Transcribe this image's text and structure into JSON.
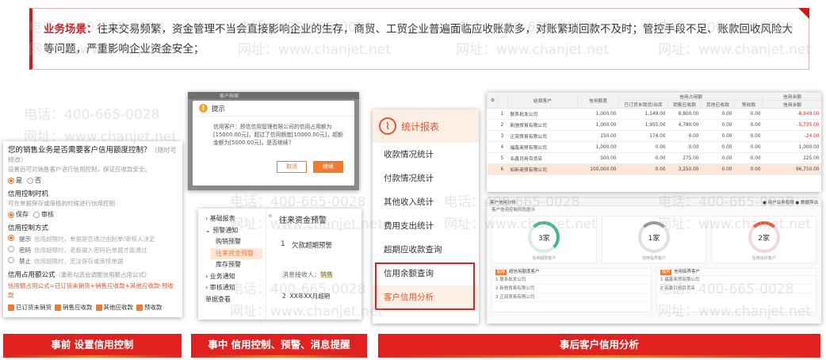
{
  "scenario": {
    "label": "业务场景：",
    "text": "往来交易频繁，资金管理不当会直接影响企业的生存，商贸、工贸企业普遍面临应收账款多，对账繁琐回款不及时；管控手段不足、账款回收风险大等问题，严重影响企业资金安全；"
  },
  "watermark": {
    "phone": "电话：400-665-0028",
    "site": "网址：www.chanjet.net"
  },
  "settings": {
    "question": "您的销售业务是否需要客户信用额度控制？",
    "question_hint": "（随时可修改）",
    "question_sub": "设置后可对销售客户进行信用控制，保证应收款安全。",
    "yes": "是",
    "no": "否",
    "timing_title": "信用控制时机",
    "timing_sub": "可在单据保存或审核的时候进行信用控制",
    "save": "保存",
    "audit": "审核",
    "method_title": "信用控制方式",
    "methods": [
      {
        "name": "提示",
        "desc": "信用超限时，单据是否通过由制单/审核人决定"
      },
      {
        "name": "密码",
        "desc": "信用超限时，老板输入密码后单据才能通过"
      },
      {
        "name": "禁止",
        "desc": "信用超限时，无法保存或审核单据"
      }
    ],
    "formula_title": "信用占用额公式",
    "formula_hint": "（重新勾选会调整信用额占用公式）",
    "formula": "信用额占用公式=已订货未销货+销售应收款+其他应收款-预收款",
    "checks": [
      "已订货未销货",
      "销售应收款",
      "其他应收款",
      "预收款"
    ]
  },
  "dialog": {
    "strip": "客户档案",
    "title": "提示",
    "body": "信用客户：即信信用管理有限公司的信用占用额为[15000.00元]，超过了信用额度[10000.00元]，超额金额为[5000.00元]，是否继续？",
    "cancel": "取消",
    "ok": "继续"
  },
  "alert_menu": {
    "items": [
      {
        "label": "基础报表",
        "sub": false,
        "prefix": "›"
      },
      {
        "label": "预警通知",
        "sub": false,
        "prefix": "⌄"
      },
      {
        "label": "购销预警",
        "sub": true
      },
      {
        "label": "往来资金预警",
        "sub": true,
        "active": true
      },
      {
        "label": "库存预警",
        "sub": true
      },
      {
        "label": "业务通知",
        "sub": false,
        "prefix": "›"
      },
      {
        "label": "审核通知",
        "sub": false,
        "prefix": "›"
      },
      {
        "label": "单据查看",
        "sub": false,
        "prefix": ""
      }
    ],
    "collapse": "«",
    "title": "往来资金预警",
    "item_num": "1",
    "item_text": "欠款超期预警",
    "receiver_label": "消息接收人：",
    "receiver": "销售",
    "last_num": "2",
    "last_text": "XX年XX月超期"
  },
  "stats_menu": {
    "title": "统计报表",
    "logo": "⌇",
    "items": [
      "收款情况统计",
      "付款情况统计",
      "其他收入统计",
      "费用支出统计",
      "超期应收款查询",
      "信用余额查询",
      "客户信用分析"
    ]
  },
  "credit_table": {
    "group_credit": "信用占用额",
    "group_balance": "信用余额",
    "headers": [
      "",
      "",
      "结算客户",
      "信用额度",
      "已订货未销货/出库",
      "销售应收款",
      "其他应收款",
      "预收款",
      "信用余额"
    ],
    "rows": [
      [
        "",
        "1",
        "联系批发公司",
        "1,000.00",
        "1,149.00",
        "8,800.00",
        "0.00",
        "0.00",
        "-8,949.00"
      ],
      [
        "",
        "2",
        "新驰贸易有限公司",
        "1,000.00",
        "1,955.00",
        "4,780.00",
        "0.00",
        "0.00",
        "-5,735.00"
      ],
      [
        "",
        "3",
        "正润贸易有限公司",
        "150.00",
        "174.00",
        "0.00",
        "0.00",
        "0.00",
        "-24.00"
      ],
      [
        "",
        "4",
        "福鑫商贸有限公司",
        "1,000.00",
        "0.00",
        "0.00",
        "0.00",
        "0.00",
        "1,000.00"
      ],
      [
        "",
        "5",
        "名鑫日用百货店",
        "500.00",
        "0.00",
        "275.00",
        "0.00",
        "0.00",
        "225.00"
      ],
      [
        "",
        "6",
        "如新商贸有限公司",
        "100,000.00",
        "0.00",
        "3,250.00",
        "0.00",
        "0.00",
        "96,750.00"
      ]
    ]
  },
  "analysis": {
    "header": "客户信用分析",
    "header_right": "● 用户业务权限  ● 数据导出",
    "sub": "客户信用控制风险提示",
    "cards": [
      {
        "value": "3家",
        "caption": "信用超限客户"
      },
      {
        "value": "1家",
        "caption": "信用临界客户"
      },
      {
        "value": "2家",
        "caption": "信用良好客户"
      }
    ],
    "list_left_tag": "超限",
    "list_left_title": "超信用额度客户",
    "list_left_rows": [
      "1  联系批发公司",
      "2  新驰贸易有限公司",
      "3  正润贸易有限公司"
    ],
    "list_right_tag": "临界",
    "list_right_title": "信用临界客户",
    "list_right_rows": [
      "1  福鑫商贸有限公司",
      "2  名鑫日用百货店"
    ]
  },
  "captions": [
    "事前 设置信用控制",
    "事中 信用控制、预警、消息提醒",
    "事后客户信用分析"
  ]
}
